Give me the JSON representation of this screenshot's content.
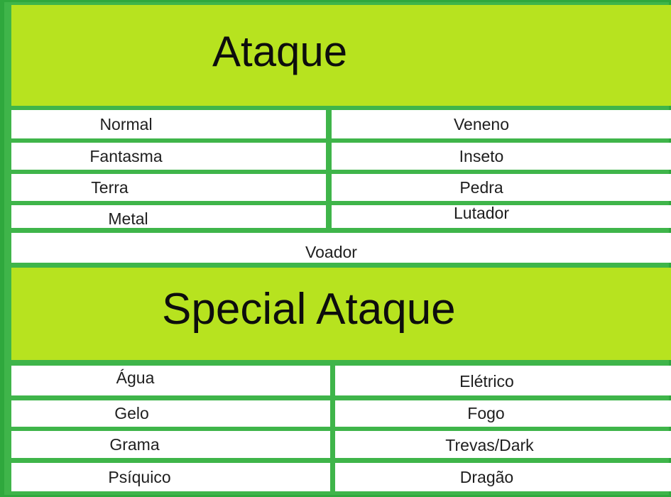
{
  "attack": {
    "title": "Ataque",
    "left": [
      "Normal",
      "Fantasma",
      "Terra",
      "Metal"
    ],
    "right": [
      "Veneno",
      "Inseto",
      "Pedra",
      "Lutador"
    ],
    "full": "Voador"
  },
  "special": {
    "title": "Special Ataque",
    "left": [
      "Água",
      "Gelo",
      "Grama",
      "Psíquico"
    ],
    "right": [
      "Elétrico",
      "Fogo",
      "Trevas/Dark",
      "Dragão"
    ]
  },
  "colors": {
    "header_bg": "#b7e31f",
    "grid_lines": "#3fb54a",
    "cell_bg": "#ffffff"
  }
}
